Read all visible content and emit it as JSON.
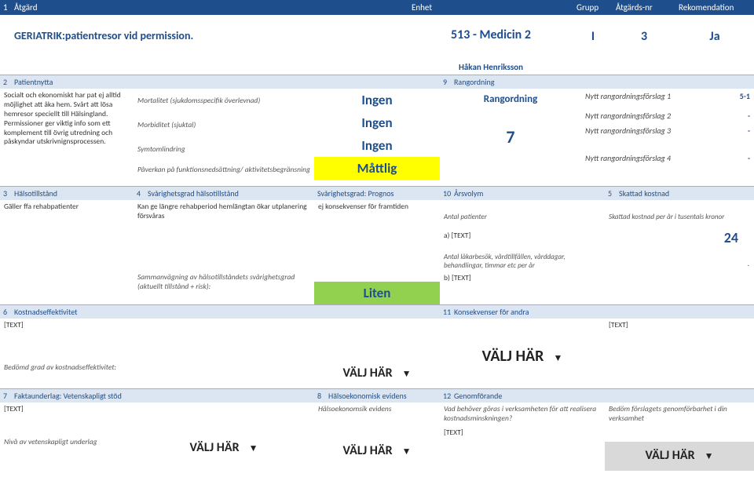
{
  "header": {
    "c0": "1",
    "c1": "Åtgärd",
    "c2": "Enhet",
    "c3": "Grupp",
    "c4": "Åtgärds-nr",
    "c5": "Rekomendation"
  },
  "main": {
    "title": "GERIATRIK:patientresor vid permission.",
    "unit": "513 - Medicin 2",
    "group": "I",
    "num": "3",
    "rec": "Ja",
    "person": "Håkan Henriksson"
  },
  "s2": {
    "num": "2",
    "label": "Patientnytta",
    "text": "Socialt och ekonomiskt har pat ej alltid möjlighet att åka hem. Svårt att lösa hemresor speciellt till Hälsingland. Permissioner ger viktig info som ett komplement till övrig utredning och påskyndar utskrivnignsprocessen.",
    "rows": [
      {
        "lab": "Mortalitet (sjukdomsspecifik överlevnad)",
        "val": "Ingen"
      },
      {
        "lab": "Morbiditet (sjuktal)",
        "val": "Ingen"
      },
      {
        "lab": "Symtomlindring",
        "val": "Ingen"
      },
      {
        "lab": "Påverkan på funktionsnedsättning/ aktivitetsbegränsning",
        "val": "Måttlig"
      }
    ]
  },
  "s9": {
    "num": "9",
    "label": "Rangordning",
    "title": "Rangordning",
    "big": "7",
    "rows": [
      {
        "lab": "Nytt rangordningsförslag 1",
        "val": "5-1"
      },
      {
        "lab": "Nytt rangordningsförslag 2",
        "val": "-"
      },
      {
        "lab": "Nytt rangordningsförslag 3",
        "val": "-"
      },
      {
        "lab": "Nytt rangordningsförslag 4",
        "val": "-"
      }
    ]
  },
  "s3": {
    "num": "3",
    "label": "Hälsotillstånd",
    "text": "Gäller ffa rehabpatienter"
  },
  "s4": {
    "num": "4",
    "label": "Svårighetsgrad hälsotillstånd",
    "text": "Kan ge längre rehabperiod  hemlängtan ökar utplanering försvåras",
    "prognos_h": "Svårighetsgrad: Prognos",
    "prognos_t": "ej konsekvenser för framtiden",
    "sum_lab": "Sammanvägning av hälsotillståndets svårighetsgrad (aktuellt tillstånd + risk):",
    "sum_val": "Liten"
  },
  "s10": {
    "num": "10",
    "label": "Årsvolym",
    "sub": "Antal patienter",
    "a": "a) [TEXT]",
    "note": "Antal läkarbesök, vårdtillfällen, vårddagar, behandlingar, timmar etc per år",
    "b": "b) [TEXT]"
  },
  "s5": {
    "num": "5",
    "label": "Skattad kostnad",
    "sub": "Skattad kostnad per år i tusentals kronor",
    "val": "24",
    "dot": "."
  },
  "s6": {
    "num": "6",
    "label": "Kostnadseffektivitet",
    "text": "[TEXT]",
    "sub": "Bedömd grad av kostnadseffektivitet:",
    "choose": "VÄLJ HÄR"
  },
  "s11": {
    "num": "11",
    "label": "Konsekvenser för andra",
    "text": "[TEXT]",
    "choose": "VÄLJ HÄR"
  },
  "s7": {
    "num": "7",
    "label": "Faktaunderlag: Vetenskapligt stöd",
    "text": "[TEXT]",
    "sub": "Nivå av vetenskapligt underlag",
    "choose": "VÄLJ HÄR"
  },
  "s8": {
    "num": "8",
    "label": "Hälsoekonomisk evidens",
    "sub": "Hälsoekonomsik evidens",
    "choose": "VÄLJ HÄR"
  },
  "s12": {
    "num": "12",
    "label": "Genomförande",
    "text": "Vad behöver göras i verksamheten för att realisera kostnadsminskningen?",
    "sub": "[TEXT]",
    "note": "Bedöm förslagets genomförbarhet i din verksamhet",
    "choose": "VÄLJ HÄR"
  },
  "tri": "▼"
}
